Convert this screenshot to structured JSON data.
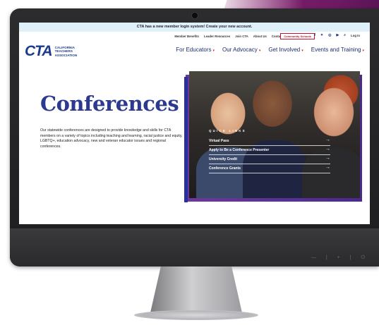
{
  "colors": {
    "brand_blue": "#1c3b8f",
    "accent_purple": "#6b3a9a",
    "alert_red": "#c8102e"
  },
  "announcement": "CTA has a new member login system! Create your new account.",
  "utility_nav": {
    "links": [
      "Member Benefits",
      "Leader Resources",
      "Join CTA",
      "About Us",
      "Contact",
      "Help Center"
    ],
    "community_schools": "Community Schools",
    "login": "Log In",
    "icons": [
      "facebook-icon",
      "twitter-icon",
      "instagram-icon",
      "youtube-icon",
      "search-icon"
    ]
  },
  "logo": {
    "mark": "CTA",
    "line1": "CALIFORNIA",
    "line2": "TEACHERS",
    "line3": "ASSOCIATION"
  },
  "main_nav": [
    {
      "label": "For Educators"
    },
    {
      "label": "Our Advocacy"
    },
    {
      "label": "Get Involved"
    },
    {
      "label": "Events and Training"
    }
  ],
  "page": {
    "title": "Conferences",
    "description": "Our statewide conferences are designed to provide knowledge and skills for CTA members on a variety of topics including teaching and learning, racial justice and equity, LGBTQ+, education advocacy, new and veteran educator issues and regional conferences."
  },
  "quick_links": {
    "title": "QUICK LINKS",
    "items": [
      {
        "label": "Virtual Pass"
      },
      {
        "label": "Apply to Be a Conference Presenter"
      },
      {
        "label": "University Credit"
      },
      {
        "label": "Conference Grants"
      }
    ],
    "arrow": "→"
  },
  "monitor": {
    "chin_buttons": "— | + | ⏻"
  }
}
